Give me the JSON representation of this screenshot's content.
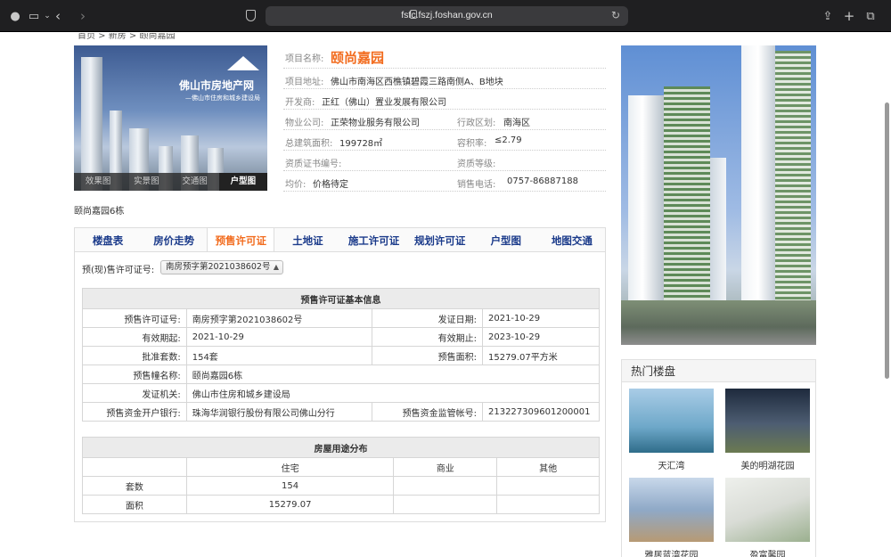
{
  "browser": {
    "url": "fsfc.fszj.foshan.gov.cn"
  },
  "breadcrumb": "首页 > 新房 > 颐尚嘉园",
  "gallery": {
    "logo_text": "佛山市房地产网",
    "logo_sub": "—佛山市住房和城乡建设局",
    "tabs": [
      "效果图",
      "实景图",
      "交通图",
      "户型图"
    ],
    "active_tab": 3,
    "caption": "颐尚嘉园6栋"
  },
  "project": {
    "name_label": "项目名称:",
    "name": "颐尚嘉园",
    "address_label": "项目地址:",
    "address": "佛山市南海区西樵镇碧霞三路南侧A、B地块",
    "developer_label": "开发商:",
    "developer": "正红（佛山）置业发展有限公司",
    "property_label": "物业公司:",
    "property": "正荣物业服务有限公司",
    "district_label": "行政区划:",
    "district": "南海区",
    "area_label": "总建筑面积:",
    "area": "199728㎡",
    "far_label": "容积率:",
    "far": "≤2.79",
    "cert_label": "资质证书编号:",
    "cert": "",
    "grade_label": "资质等级:",
    "grade": "",
    "price_label": "均价:",
    "price": "价格待定",
    "phone_label": "销售电话:",
    "phone": "0757-86887188"
  },
  "tabs": [
    "楼盘表",
    "房价走势",
    "预售许可证",
    "土地证",
    "施工许可证",
    "规划许可证",
    "户型图",
    "地图交通"
  ],
  "active_tab": 2,
  "license_select": {
    "label": "预(现)售许可证号:",
    "value": "南房预字第2021038602号"
  },
  "license_table": {
    "title": "预售许可证基本信息",
    "rows": [
      {
        "k1": "预售许可证号:",
        "v1": "南房预字第2021038602号",
        "k2": "发证日期:",
        "v2": "2021-10-29"
      },
      {
        "k1": "有效期起:",
        "v1": "2021-10-29",
        "k2": "有效期止:",
        "v2": "2023-10-29"
      },
      {
        "k1": "批准套数:",
        "v1": "154套",
        "k2": "预售面积:",
        "v2": "15279.07平方米"
      },
      {
        "k1": "预售幢名称:",
        "v1": "颐尚嘉园6栋"
      },
      {
        "k1": "发证机关:",
        "v1": "佛山市住房和城乡建设局"
      },
      {
        "k1": "预售资金开户银行:",
        "v1": "珠海华润银行股份有限公司佛山分行",
        "k2": "预售资金监管帐号:",
        "v2": "213227309601200001"
      }
    ]
  },
  "usage_table": {
    "title": "房屋用途分布",
    "columns": [
      "",
      "住宅",
      "商业",
      "其他"
    ],
    "rows": [
      [
        "套数",
        "154",
        "",
        ""
      ],
      [
        "面积",
        "15279.07",
        "",
        ""
      ]
    ]
  },
  "hot": {
    "title": "热门楼盘",
    "items": [
      {
        "name": "天汇湾",
        "color": "#6ea8c9"
      },
      {
        "name": "美的明湖花园",
        "color": "#4d5d72"
      },
      {
        "name": "雅居蓝湾花园",
        "color": "#8fa9c7"
      },
      {
        "name": "盈富馨园",
        "color": "#d9dcd6"
      }
    ]
  },
  "colors": {
    "accent": "#f26b1d",
    "tab_text": "#1a3a8a"
  }
}
